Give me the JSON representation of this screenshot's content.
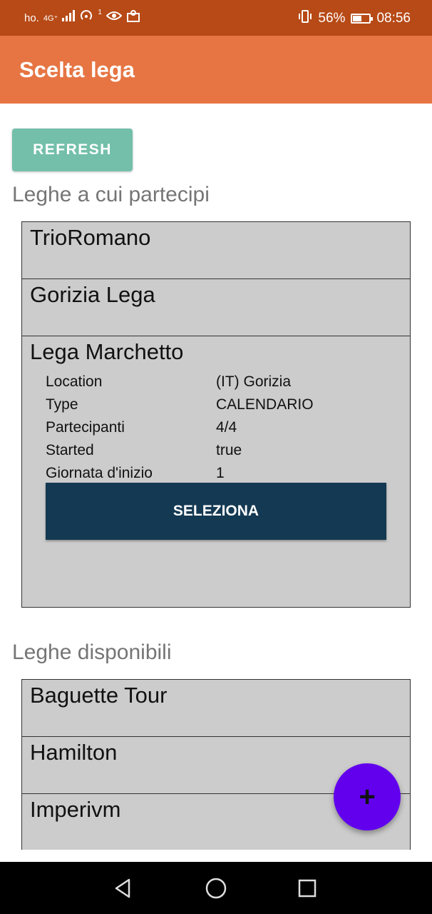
{
  "status_bar": {
    "carrier": "ho.",
    "network": "4G⁺",
    "notification_count": "1",
    "battery": "56%",
    "battery_level": 0.56,
    "time": "08:56"
  },
  "app_bar": {
    "title": "Scelta lega"
  },
  "refresh_label": "REFRESH",
  "my_leagues": {
    "title": "Leghe a cui partecipi",
    "items": [
      {
        "name": "TrioRomano"
      },
      {
        "name": "Gorizia Lega"
      },
      {
        "name": "Lega Marchetto",
        "details": [
          {
            "label": "Location",
            "value": "(IT) Gorizia"
          },
          {
            "label": "Type",
            "value": "CALENDARIO"
          },
          {
            "label": "Partecipanti",
            "value": "4/4"
          },
          {
            "label": "Started",
            "value": "true"
          },
          {
            "label": "Giornata d'inizio",
            "value": "1"
          }
        ],
        "select_label": "SELEZIONA"
      }
    ]
  },
  "available_leagues": {
    "title": "Leghe disponibili",
    "items": [
      {
        "name": "Baguette Tour"
      },
      {
        "name": "Hamilton"
      },
      {
        "name": "Imperivm"
      }
    ]
  },
  "fab": {
    "icon": "plus-icon",
    "label": "+"
  },
  "colors": {
    "status_bar": "#b74a16",
    "app_bar": "#e67543",
    "refresh_button": "#73bfaa",
    "select_button": "#143953",
    "fab": "#6200ee",
    "list_item_bg": "#cccccc"
  }
}
